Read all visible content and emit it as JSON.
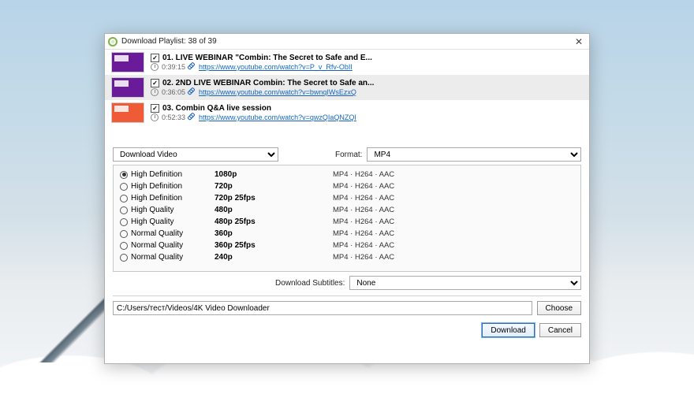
{
  "window": {
    "title": "Download Playlist: 38 of 39"
  },
  "playlist": [
    {
      "checked": true,
      "title": "01. LIVE WEBINAR \"Combin: The Secret to Safe and E...",
      "duration": "0:39:15",
      "url": "https://www.youtube.com/watch?v=P_v_Rfv-ObII",
      "thumb": "purple",
      "selected": false
    },
    {
      "checked": true,
      "title": "02. 2ND LIVE WEBINAR Combin: The Secret to Safe an...",
      "duration": "0:36:05",
      "url": "https://www.youtube.com/watch?v=bwnqIWsEzxQ",
      "thumb": "purple",
      "selected": true
    },
    {
      "checked": true,
      "title": "03. Combin Q&A live session",
      "duration": "0:52:33",
      "url": "https://www.youtube.com/watch?v=qwzQIaQNZQI",
      "thumb": "orange",
      "selected": false
    }
  ],
  "action": {
    "label": "Download Video"
  },
  "format": {
    "label": "Format:",
    "value": "MP4"
  },
  "qualities": [
    {
      "tier": "High Definition",
      "res": "1080p",
      "codec": "MP4 · H264 · AAC",
      "selected": true
    },
    {
      "tier": "High Definition",
      "res": "720p",
      "codec": "MP4 · H264 · AAC",
      "selected": false
    },
    {
      "tier": "High Definition",
      "res": "720p 25fps",
      "codec": "MP4 · H264 · AAC",
      "selected": false
    },
    {
      "tier": "High Quality",
      "res": "480p",
      "codec": "MP4 · H264 · AAC",
      "selected": false
    },
    {
      "tier": "High Quality",
      "res": "480p 25fps",
      "codec": "MP4 · H264 · AAC",
      "selected": false
    },
    {
      "tier": "Normal Quality",
      "res": "360p",
      "codec": "MP4 · H264 · AAC",
      "selected": false
    },
    {
      "tier": "Normal Quality",
      "res": "360p 25fps",
      "codec": "MP4 · H264 · AAC",
      "selected": false
    },
    {
      "tier": "Normal Quality",
      "res": "240p",
      "codec": "MP4 · H264 · AAC",
      "selected": false
    }
  ],
  "subtitles": {
    "label": "Download Subtitles:",
    "value": "None"
  },
  "path": {
    "value": "C:/Users/тест/Videos/4K Video Downloader",
    "choose": "Choose"
  },
  "buttons": {
    "download": "Download",
    "cancel": "Cancel"
  }
}
